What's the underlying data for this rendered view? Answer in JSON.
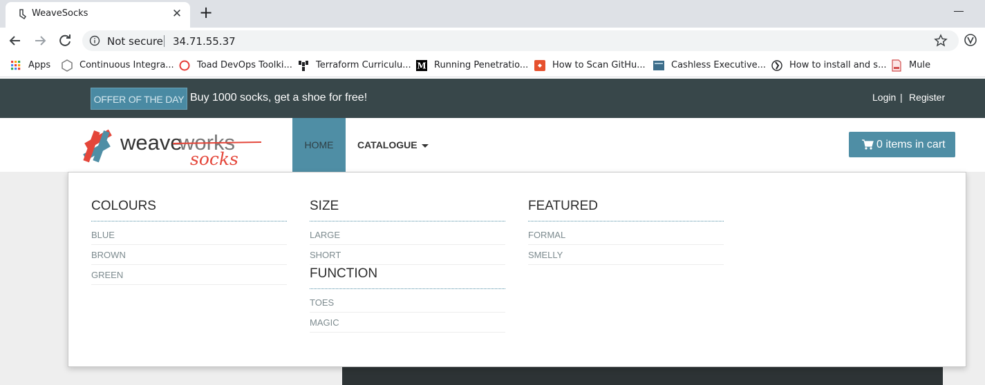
{
  "browser": {
    "tab_title": "WeaveSocks",
    "tab_close": "✕",
    "new_tab": "+",
    "security_label": "Not secure",
    "url": "34.71.55.37",
    "bookmarks": [
      {
        "label": "Apps",
        "icon": "apps-grid-icon",
        "color": "#e94235"
      },
      {
        "label": "Continuous Integra...",
        "icon": "hexagon-icon",
        "color": "#7a7a7a"
      },
      {
        "label": "Toad DevOps Toolki...",
        "icon": "toad-ring-icon",
        "color": "#e53935"
      },
      {
        "label": "Terraform Curriculu...",
        "icon": "terraform-icon",
        "color": "#202124"
      },
      {
        "label": "Running Penetratio...",
        "icon": "medium-icon",
        "color": "#000000"
      },
      {
        "label": "How to Scan GitHu...",
        "icon": "red-tile-icon",
        "color": "#e6512e"
      },
      {
        "label": "Cashless Executive...",
        "icon": "doc-tile-icon",
        "color": "#3d6d8a"
      },
      {
        "label": "How to install and s...",
        "icon": "silhouette-icon",
        "color": "#202124"
      },
      {
        "label": "Mule",
        "icon": "doc-page-icon",
        "color": "#d04b4b"
      }
    ]
  },
  "topbar": {
    "offer_badge": "OFFER OF THE DAY",
    "offer_text": "Buy 1000 socks, get a shoe for free!",
    "login": "Login",
    "separator": "|",
    "register": "Register"
  },
  "logo": {
    "brand_primary": "weave",
    "brand_secondary": "works",
    "brand_sub": "socks"
  },
  "nav": {
    "home": "HOME",
    "catalogue": "CATALOGUE",
    "cart": "0 items in cart"
  },
  "menu": {
    "columns": [
      {
        "groups": [
          {
            "heading": "COLOURS",
            "items": [
              "BLUE",
              "BROWN",
              "GREEN"
            ]
          }
        ]
      },
      {
        "groups": [
          {
            "heading": "SIZE",
            "items": [
              "LARGE",
              "SHORT"
            ]
          },
          {
            "heading": "FUNCTION",
            "items": [
              "TOES",
              "MAGIC"
            ]
          }
        ]
      },
      {
        "groups": [
          {
            "heading": "FEATURED",
            "items": [
              "FORMAL",
              "SMELLY"
            ]
          }
        ]
      }
    ]
  },
  "colors": {
    "topbar": "#38474a",
    "accent": "#4f8ea5",
    "logo_red": "#e4463a"
  }
}
